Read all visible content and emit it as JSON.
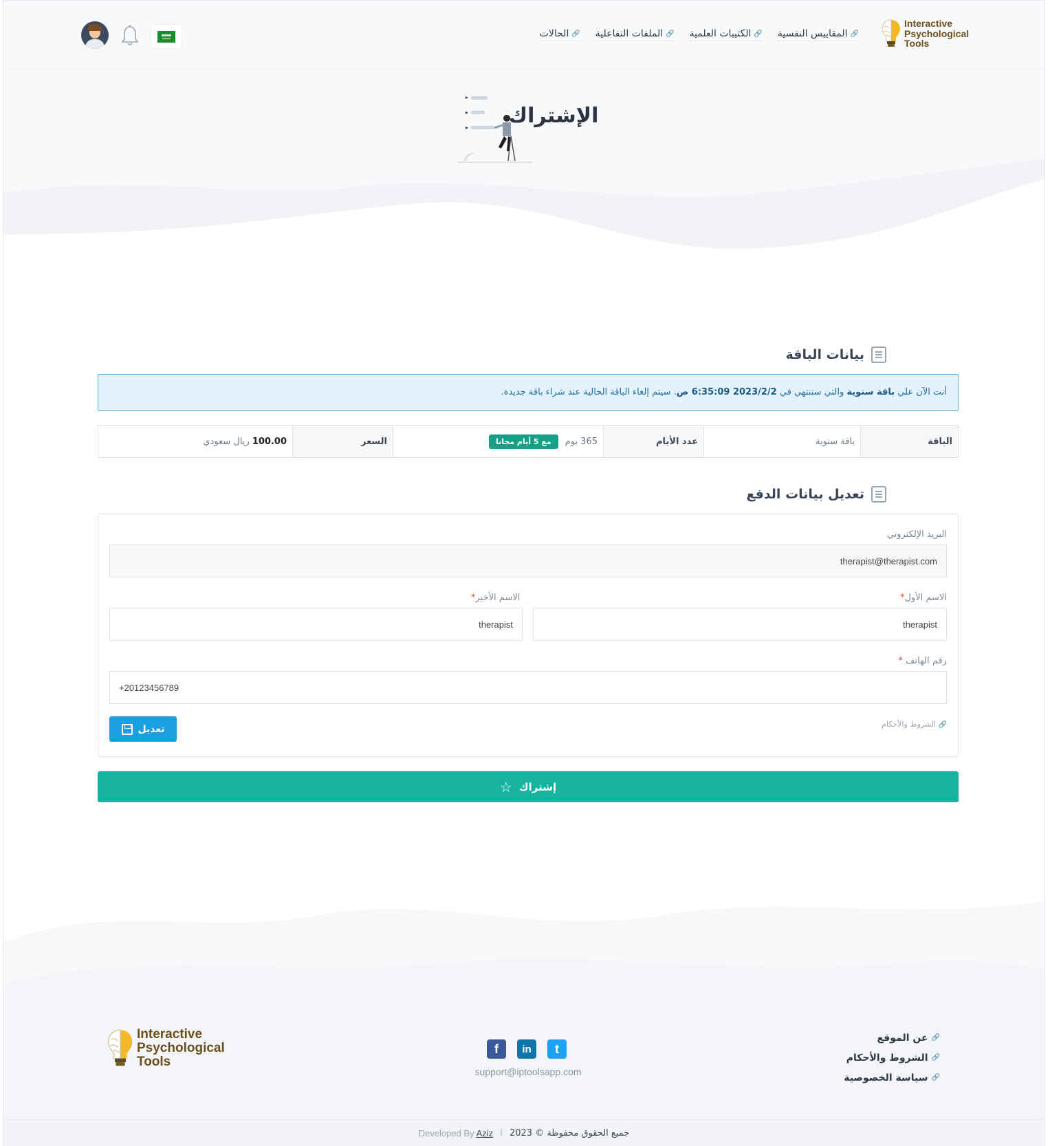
{
  "header": {
    "logo": {
      "line1": "Interactive",
      "line2": "Psychological",
      "line3": "Tools"
    },
    "nav": [
      {
        "label": "المقاييس النفسية"
      },
      {
        "label": "الكتيبات العلمية"
      },
      {
        "label": "الملفات التفاعلية"
      },
      {
        "label": "الحالات"
      }
    ]
  },
  "hero": {
    "title": "الإشتراك"
  },
  "plan_section": {
    "title": "بيانات الباقة",
    "alert": {
      "prefix": "أنت الآن علي",
      "plan": "باقة سنوية",
      "middle": "والتي ستنتهي في",
      "date": "2023/2/2 6:35:09 ص",
      "suffix": ". سيتم إلغاء الباقة الحالية عند شراء باقة جديدة."
    },
    "table": {
      "plan_label": "الباقة",
      "plan_value": "باقة سنوية",
      "days_label": "عدد الأيام",
      "days_value": "365 يوم",
      "days_badge": "مع 5 أيام مجانا",
      "price_label": "السعر",
      "price_amount": "100.00",
      "price_currency": "ريال سعودي"
    }
  },
  "payment_section": {
    "title": "تعديل بيانات الدفع",
    "email_label": "البريد الإلكتروني",
    "email_value": "therapist@therapist.com",
    "first_name_label": "الاسم الأول",
    "first_name_value": "therapist",
    "last_name_label": "الاسم الأخير",
    "last_name_value": "therapist",
    "phone_label": "رقم الهاتف",
    "phone_value": "+20123456789",
    "required_mark": "*",
    "terms_link": "الشروط والأحكام",
    "edit_button": "تعديل"
  },
  "subscribe_button": "إشتراك",
  "footer": {
    "links": [
      {
        "label": "عن الموقع"
      },
      {
        "label": "الشروط والأحكام"
      },
      {
        "label": "سياسة الخصوصية"
      }
    ],
    "support_email": "support@iptoolsapp.com",
    "copyright": "جميع الحقوق محفوظة © 2023",
    "separator": "I",
    "developed_by": "Developed By",
    "developer": "Aziz"
  },
  "colors": {
    "accent_green": "#16b3a1",
    "primary_blue": "#1a9fe0",
    "badge_green": "#16a085",
    "alert_bg": "#e4f2fc",
    "logo_yellow": "#f0b323",
    "logo_brown": "#6b4e1a"
  }
}
